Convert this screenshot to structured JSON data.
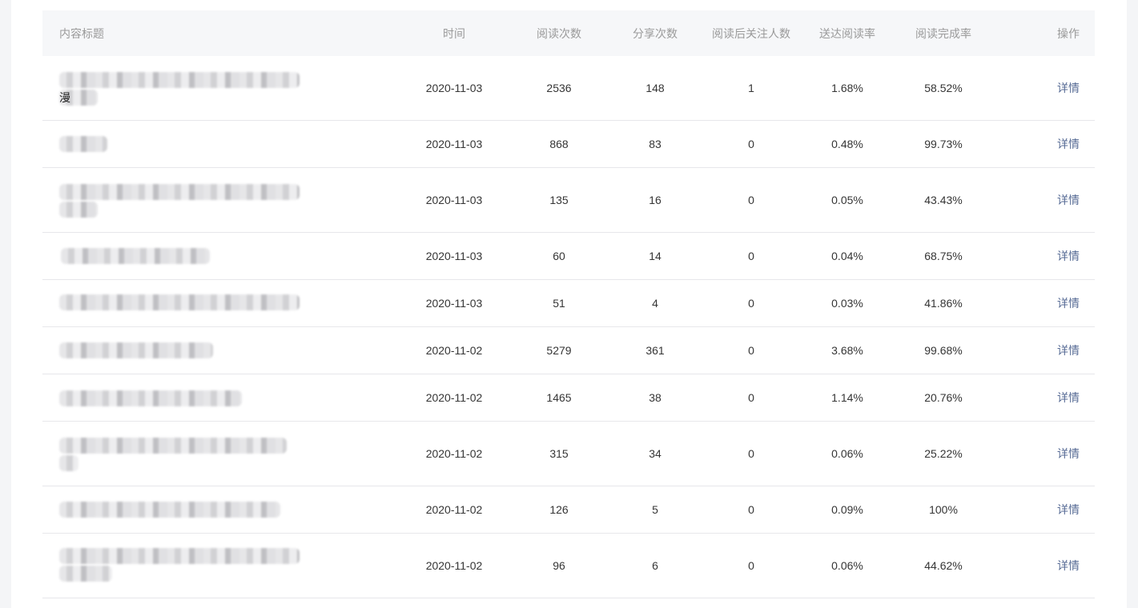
{
  "table": {
    "headers": {
      "title": "内容标题",
      "time": "时间",
      "reads": "阅读次数",
      "shares": "分享次数",
      "follows": "阅读后关注人数",
      "delivery_rate": "送达阅读率",
      "completion_rate": "阅读完成率",
      "action": "操作"
    },
    "rows": [
      {
        "time": "2020-11-03",
        "reads": "2536",
        "shares": "148",
        "follows": "1",
        "delivery_rate": "1.68%",
        "completion_rate": "58.52%",
        "action": "详情",
        "title_fragment": "漫"
      },
      {
        "time": "2020-11-03",
        "reads": "868",
        "shares": "83",
        "follows": "0",
        "delivery_rate": "0.48%",
        "completion_rate": "99.73%",
        "action": "详情"
      },
      {
        "time": "2020-11-03",
        "reads": "135",
        "shares": "16",
        "follows": "0",
        "delivery_rate": "0.05%",
        "completion_rate": "43.43%",
        "action": "详情"
      },
      {
        "time": "2020-11-03",
        "reads": "60",
        "shares": "14",
        "follows": "0",
        "delivery_rate": "0.04%",
        "completion_rate": "68.75%",
        "action": "详情"
      },
      {
        "time": "2020-11-03",
        "reads": "51",
        "shares": "4",
        "follows": "0",
        "delivery_rate": "0.03%",
        "completion_rate": "41.86%",
        "action": "详情"
      },
      {
        "time": "2020-11-02",
        "reads": "5279",
        "shares": "361",
        "follows": "0",
        "delivery_rate": "3.68%",
        "completion_rate": "99.68%",
        "action": "详情"
      },
      {
        "time": "2020-11-02",
        "reads": "1465",
        "shares": "38",
        "follows": "0",
        "delivery_rate": "1.14%",
        "completion_rate": "20.76%",
        "action": "详情"
      },
      {
        "time": "2020-11-02",
        "reads": "315",
        "shares": "34",
        "follows": "0",
        "delivery_rate": "0.06%",
        "completion_rate": "25.22%",
        "action": "详情"
      },
      {
        "time": "2020-11-02",
        "reads": "126",
        "shares": "5",
        "follows": "0",
        "delivery_rate": "0.09%",
        "completion_rate": "100%",
        "action": "详情"
      },
      {
        "time": "2020-11-02",
        "reads": "96",
        "shares": "6",
        "follows": "0",
        "delivery_rate": "0.06%",
        "completion_rate": "44.62%",
        "action": "详情"
      }
    ]
  }
}
